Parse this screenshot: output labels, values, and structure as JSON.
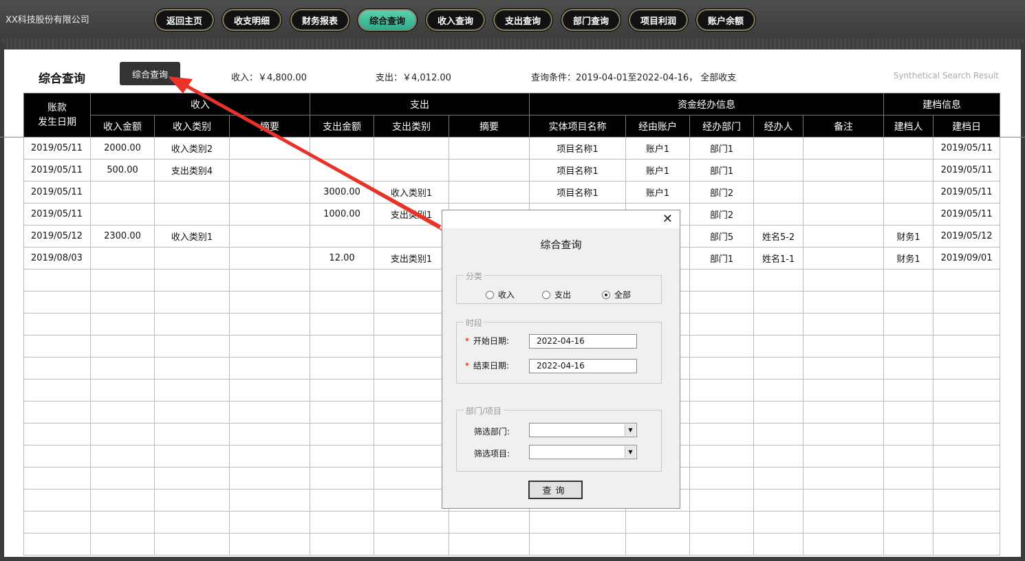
{
  "app": {
    "company": "XX科技股份有限公司"
  },
  "nav": [
    {
      "label": "返回主页",
      "active": false
    },
    {
      "label": "收支明细",
      "active": false
    },
    {
      "label": "财务报表",
      "active": false
    },
    {
      "label": "综合查询",
      "active": true
    },
    {
      "label": "收入查询",
      "active": false
    },
    {
      "label": "支出查询",
      "active": false
    },
    {
      "label": "部门查询",
      "active": false
    },
    {
      "label": "项目利润",
      "active": false
    },
    {
      "label": "账户余额",
      "active": false
    }
  ],
  "page": {
    "title": "综合查询",
    "tooltip": "综合查询",
    "income_summary": "收入：￥4,800.00",
    "expense_summary": "支出：￥4,012.00",
    "condition": "查询条件：2019-04-01至2022-04-16， 全部收支",
    "en_title": "Synthetical Search Result"
  },
  "table": {
    "group_headers": {
      "date": "账款发生日期",
      "income": "收入",
      "expense": "支出",
      "fund": "资金经办信息",
      "archive": "建档信息"
    },
    "columns": [
      "收入金额",
      "收入类别",
      "摘要",
      "支出金额",
      "支出类别",
      "摘要",
      "实体项目名称",
      "经由账户",
      "经办部门",
      "经办人",
      "备注",
      "建档人",
      "建档日"
    ],
    "rows": [
      [
        "2019/05/11",
        "2000.00",
        "收入类别2",
        "",
        "",
        "",
        "",
        "项目名称1",
        "账户1",
        "部门1",
        "",
        "",
        "",
        "2019/05/11"
      ],
      [
        "2019/05/11",
        "500.00",
        "支出类别4",
        "",
        "",
        "",
        "",
        "项目名称1",
        "账户1",
        "部门1",
        "",
        "",
        "",
        "2019/05/11"
      ],
      [
        "2019/05/11",
        "",
        "",
        "",
        "3000.00",
        "收入类别1",
        "",
        "项目名称1",
        "账户1",
        "部门2",
        "",
        "",
        "",
        "2019/05/11"
      ],
      [
        "2019/05/11",
        "",
        "",
        "",
        "1000.00",
        "支出类别1",
        "",
        "",
        "",
        "部门2",
        "",
        "",
        "",
        "2019/05/11"
      ],
      [
        "2019/05/12",
        "2300.00",
        "收入类别1",
        "",
        "",
        "",
        "",
        "",
        "",
        "部门5",
        "姓名5-2",
        "",
        "财务1",
        "2019/05/12"
      ],
      [
        "2019/08/03",
        "",
        "",
        "",
        "12.00",
        "支出类别1",
        "",
        "",
        "",
        "部门1",
        "姓名1-1",
        "",
        "财务1",
        "2019/09/01"
      ]
    ],
    "empty_rows": 13
  },
  "dialog": {
    "title": "综合查询",
    "category_legend": "分类",
    "radios": [
      {
        "label": "收入",
        "checked": false
      },
      {
        "label": "支出",
        "checked": false
      },
      {
        "label": "全部",
        "checked": true
      }
    ],
    "period_legend": "时段",
    "start_label": "开始日期:",
    "start_value": "2022-04-16",
    "end_label": "结束日期:",
    "end_value": "2022-04-16",
    "filter_legend": "部门/项目",
    "dept_label": "筛选部门:",
    "proj_label": "筛选项目:",
    "query_button": "查询",
    "close": "✕"
  },
  "colors": {
    "accent": "#3fbf9c",
    "topbar": "#444444",
    "annotation_arrow": "#e8332a"
  }
}
